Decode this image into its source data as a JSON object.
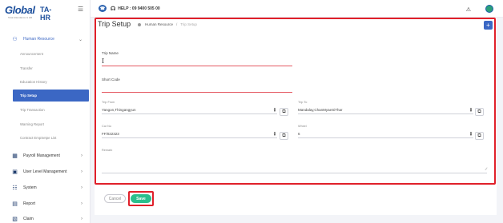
{
  "brand": {
    "logo_main": "Global",
    "logo_suffix": "TA-HR",
    "logo_sub": "Total Attendance & HR"
  },
  "topbar": {
    "help_text": "HELP : 09 9400 505 00"
  },
  "sidebar": {
    "parents": [
      {
        "label": "Human Resource",
        "icon": "users-icon"
      },
      {
        "label": "Payroll Management",
        "icon": "payroll-icon"
      },
      {
        "label": "User Level Management",
        "icon": "user-level-icon"
      },
      {
        "label": "System",
        "icon": "system-icon"
      },
      {
        "label": "Report",
        "icon": "report-icon"
      },
      {
        "label": "Claim",
        "icon": "claim-icon"
      }
    ],
    "subs": [
      {
        "label": "Announcement"
      },
      {
        "label": "Transfer"
      },
      {
        "label": "Education History"
      },
      {
        "label": "Trip Setup"
      },
      {
        "label": "Trip Transaction"
      },
      {
        "label": "Warning Report"
      },
      {
        "label": "Contract EmpSetpe List"
      }
    ]
  },
  "page": {
    "title": "Trip Setup",
    "breadcrumb": {
      "parent": "Human Resource",
      "current": "Trip Setup"
    }
  },
  "form": {
    "trip_name_label": "Trip Name",
    "trip_name_value": "",
    "short_code_label": "Short Code",
    "trip_from_label": "Trip From",
    "trip_from_value": "Yangon,Thingangyun",
    "trip_to_label": "Trip To",
    "trip_to_value": "Mandalay,ChanMyaeSiThar",
    "car_no_label": "Car No",
    "car_no_value": "FF/022323",
    "wheel_label": "Wheel",
    "wheel_value": "6",
    "remark_label": "Remark"
  },
  "actions": {
    "cancel_label": "Cancel",
    "save_label": "Save"
  },
  "colors": {
    "accent": "#3b67c4",
    "save": "#2bbf8d",
    "highlight": "#e0202a"
  }
}
